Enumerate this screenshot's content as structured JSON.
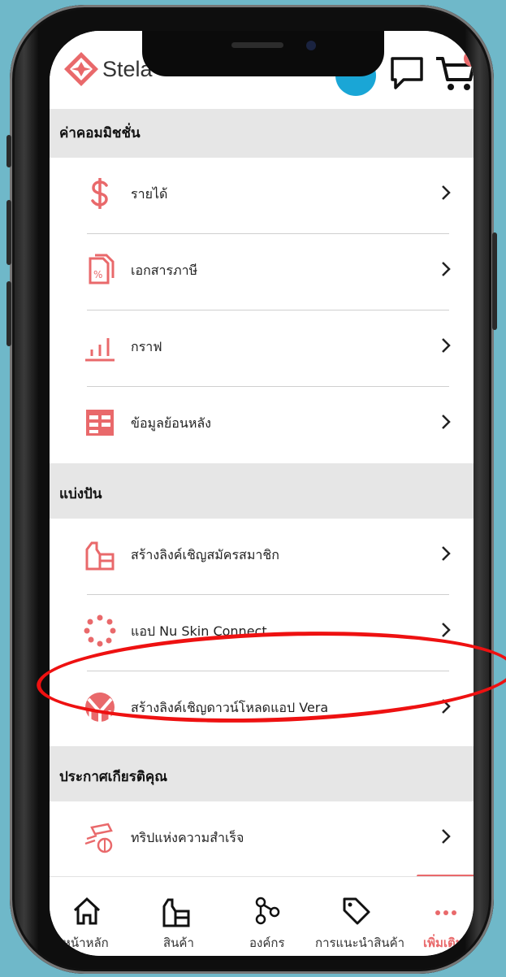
{
  "app": {
    "logo_text": "Stela"
  },
  "colors": {
    "accent": "#e9696b",
    "link_blue": "#1aa6d6",
    "section_bg": "#e6e6e6",
    "annotation": "#e11111"
  },
  "sections": [
    {
      "title": "ค่าคอมมิชชั่น",
      "items": [
        {
          "label": "รายได้",
          "icon": "dollar-icon"
        },
        {
          "label": "เอกสารภาษี",
          "icon": "tax-document-icon"
        },
        {
          "label": "กราฟ",
          "icon": "bar-graph-icon"
        },
        {
          "label": "ข้อมูลย้อนหลัง",
          "icon": "table-icon"
        }
      ]
    },
    {
      "title": "แบ่งปัน",
      "items": [
        {
          "label": "สร้างลิงค์เชิญสมัครสมาชิก",
          "icon": "products-icon"
        },
        {
          "label": "แอป Nu Skin Connect",
          "icon": "dots-circle-icon"
        },
        {
          "label": "สร้างลิงค์เชิญดาวน์โหลดแอป Vera",
          "icon": "vera-icon"
        }
      ]
    },
    {
      "title": "ประกาศเกียรติคุณ",
      "items": [
        {
          "label": "ทริปแห่งความสำเร็จ",
          "icon": "trip-icon"
        }
      ]
    }
  ],
  "bottom_nav": [
    {
      "label": "หน้าหลัก",
      "icon": "home-icon"
    },
    {
      "label": "สินค้า",
      "icon": "products-icon"
    },
    {
      "label": "องค์กร",
      "icon": "organization-icon"
    },
    {
      "label": "การแนะนำสินค้า",
      "icon": "tag-icon"
    },
    {
      "label": "เพิ่มเติม",
      "icon": "more-icon",
      "active": true
    }
  ]
}
